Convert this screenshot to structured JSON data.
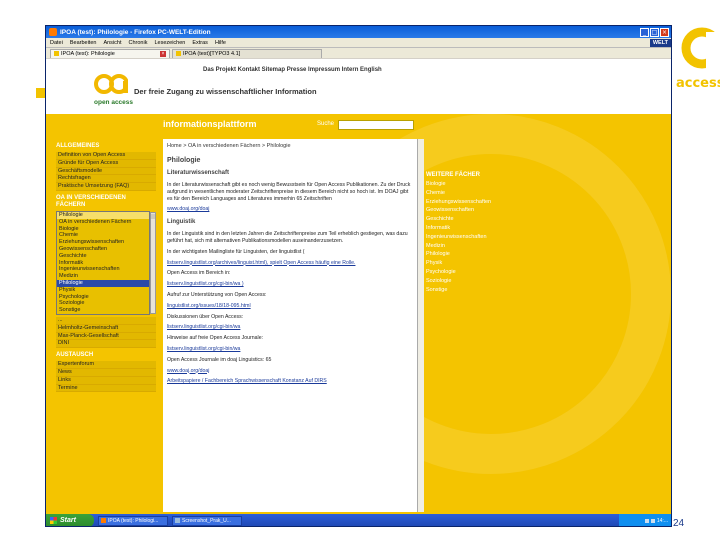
{
  "window": {
    "title": "IPOA (test): Philologie - Firefox PC-WELT-Edition",
    "menus": [
      "Datei",
      "Bearbeiten",
      "Ansicht",
      "Chronik",
      "Lesezeichen",
      "Extras",
      "Hilfe"
    ],
    "brand": "WELT"
  },
  "tabs": [
    {
      "label": "IPOA (test): Philologie"
    },
    {
      "label": "IPOA (test)[TYPO3 4.1]"
    }
  ],
  "site": {
    "topnav": "Das Projekt  Kontakt  Sitemap  Presse  Impressum  Intern  English",
    "logo_text": "open access",
    "tagline": "Der freie Zugang zu wissenschaftlicher Information",
    "section_title": "informationsplattform",
    "search_label": "Suche"
  },
  "left": {
    "general_heading": "ALLGEMEINES",
    "general_items": [
      "Definition von Open Access",
      "Gründe für Open Access",
      "Geschäftsmodelle",
      "Rechtsfragen",
      "Praktische Umsetzung (FAQ)"
    ],
    "subjects_heading": "OA IN VERSCHIEDENEN FÄCHERN",
    "subject_items": [
      "Philologie",
      "OA in verschiedenen Fächern",
      "Biologie",
      "Chemie",
      "Erziehungswissenschaften",
      "Geowissenschaften",
      "Geschichte",
      "Informatik",
      "Ingenieurwissenschaften",
      "Medizin",
      "Philologie",
      "Physik",
      "Psychologie",
      "Soziologie",
      "Sonstige"
    ],
    "more_items": [
      "...",
      "Helmholtz-Gemeinschaft",
      "Max-Planck-Gesellschaft",
      "DINI"
    ],
    "exchange_heading": "AUSTAUSCH",
    "exchange_items": [
      "Expertenforum",
      "News",
      "Links",
      "Termine"
    ]
  },
  "main": {
    "breadcrumb": "Home > OA in verschiedenen Fächern > Philologie",
    "heading": "Philologie",
    "sub1": "Literaturwissenschaft",
    "para1": "In der Literaturwissenschaft gibt es noch wenig Bewusstsein für Open Access Publikationen. Zu der Druck aufgrund in wesentlichen moderater Zeitschriftenpreise in diesem Bereich nicht so hoch ist. Im DOAJ gibt es für den Bereich Languages and Literatures immerhin 65 Zeitschriften",
    "link1": "www.doaj.org/doaj",
    "sub2": "Linguistik",
    "para2": "In der Linguistik sind in den letzten Jahren die Zeitschriftenpreise zum Teil erheblich gestiegen, was dazu geführt hat, sich mit alternativen Publikationsmodellen auseinanderzusetzen.",
    "para3": "In der wichtigsten Mailingliste für Linguisten, der linguistlist (",
    "link2": "listserv.linguistlist.org/archives/linguist.html), spielt Open Access häufig eine Rolle.",
    "para4": "Open Access im Bereich in:",
    "link3": "listserv.linguistlist.org/cgi-bin/wa )",
    "para5": "Aufruf zur Unterstützung von Open Access:",
    "link4": "linguistlist.org/issues/18/18-095.html",
    "para6": "Diskussionen über Open Access:",
    "link5": "listserv.linguistlist.org/cgi-bin/wa",
    "para7": "Hinweise auf freie Open Access Journale:",
    "link6": "listserv.linguistlist.org/cgi-bin/wa",
    "para8": "Open Access Journale im doaj Linguistics: 65",
    "link7": "www.doaj.org/doaj",
    "footer_link": "Arbeitspapiere / Fachbereich Sprachwissenschaft Konstanz Auf DIRS"
  },
  "right": {
    "heading": "WEITERE FÄCHER",
    "items": [
      "Biologie",
      "Chemie",
      "Erziehungswissenschaften",
      "Geowissenschaften",
      "Geschichte",
      "Informatik",
      "Ingenieurwissenschaften",
      "Medizin",
      "Philologie",
      "Physik",
      "Psychologie",
      "Soziologie",
      "Sonstige"
    ]
  },
  "taskbar": {
    "start": "Start",
    "task1": "IPOA (test): Philologi...",
    "task2": "Screenshot_Prak_U...",
    "clock": "14:..."
  },
  "slide": {
    "bg_logo_text": "access",
    "number": "24"
  },
  "colors": {
    "site_yellow": "#f4c400",
    "selection_blue": "#2b4aa8",
    "link_blue": "#1a3a9a"
  }
}
